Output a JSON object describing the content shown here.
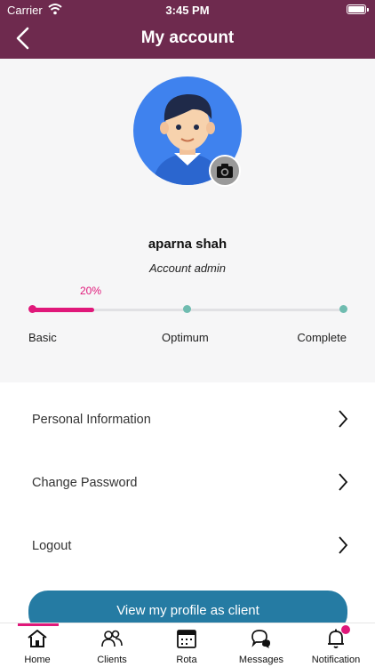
{
  "status_bar": {
    "carrier": "Carrier",
    "time": "3:45 PM"
  },
  "header": {
    "title": "My account",
    "back_icon": "chevron-left-icon"
  },
  "profile": {
    "name": "aparna shah",
    "role": "Account admin",
    "camera_icon": "camera-icon",
    "progress": {
      "value_label": "20%",
      "value": 0.2,
      "levels": [
        "Basic",
        "Optimum",
        "Complete"
      ]
    }
  },
  "menu": {
    "items": [
      {
        "label": "Personal Information"
      },
      {
        "label": "Change Password"
      },
      {
        "label": "Logout"
      }
    ]
  },
  "cta": {
    "label": "View my profile as client"
  },
  "tabs": [
    {
      "label": "Home",
      "icon": "home-icon",
      "active": true
    },
    {
      "label": "Clients",
      "icon": "users-icon"
    },
    {
      "label": "Rota",
      "icon": "calendar-icon"
    },
    {
      "label": "Messages",
      "icon": "chat-icon"
    },
    {
      "label": "Notification",
      "icon": "bell-icon",
      "badge": true
    }
  ],
  "colors": {
    "header": "#6e2a4e",
    "accent": "#e0187a",
    "button": "#257ba3",
    "teal": "#6fbcb0"
  }
}
